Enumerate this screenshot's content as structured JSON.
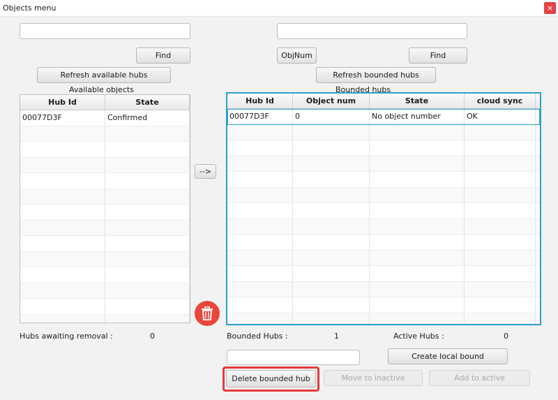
{
  "window": {
    "title": "Objects menu",
    "close_glyph": "×"
  },
  "left": {
    "search_value": "",
    "find_label": "Find",
    "refresh_label": "Refresh available hubs",
    "section_label": "Available objects",
    "columns": [
      "Hub Id",
      "State"
    ],
    "rows": [
      [
        "00077D3F",
        "Confirmed"
      ]
    ],
    "awaiting_label": "Hubs awaiting removal :",
    "awaiting_count": "0"
  },
  "move_right_label": "-->",
  "right": {
    "search_value": "",
    "objnum_label": "ObjNum",
    "find_label": "Find",
    "refresh_label": "Refresh bounded hubs",
    "section_label": "Bounded hubs",
    "columns": [
      "Hub Id",
      "Object num",
      "State",
      "cloud sync"
    ],
    "rows": [
      [
        "00077D3F",
        "0",
        "No object number",
        "OK"
      ]
    ],
    "bounded_label": "Bounded Hubs :",
    "bounded_count": "1",
    "active_label": "Active Hubs :",
    "active_count": "0"
  },
  "bottom": {
    "local_input_value": "",
    "create_local_label": "Create local bound",
    "delete_label": "Delete bounded hub",
    "move_inactive_label": "Move to inactive",
    "add_active_label": "Add to active"
  },
  "colors": {
    "accent": "#2ba0cc",
    "danger": "#e8473a",
    "highlight": "#e33a3a"
  },
  "icons": {
    "delete": "trash-icon",
    "close": "close-icon"
  }
}
